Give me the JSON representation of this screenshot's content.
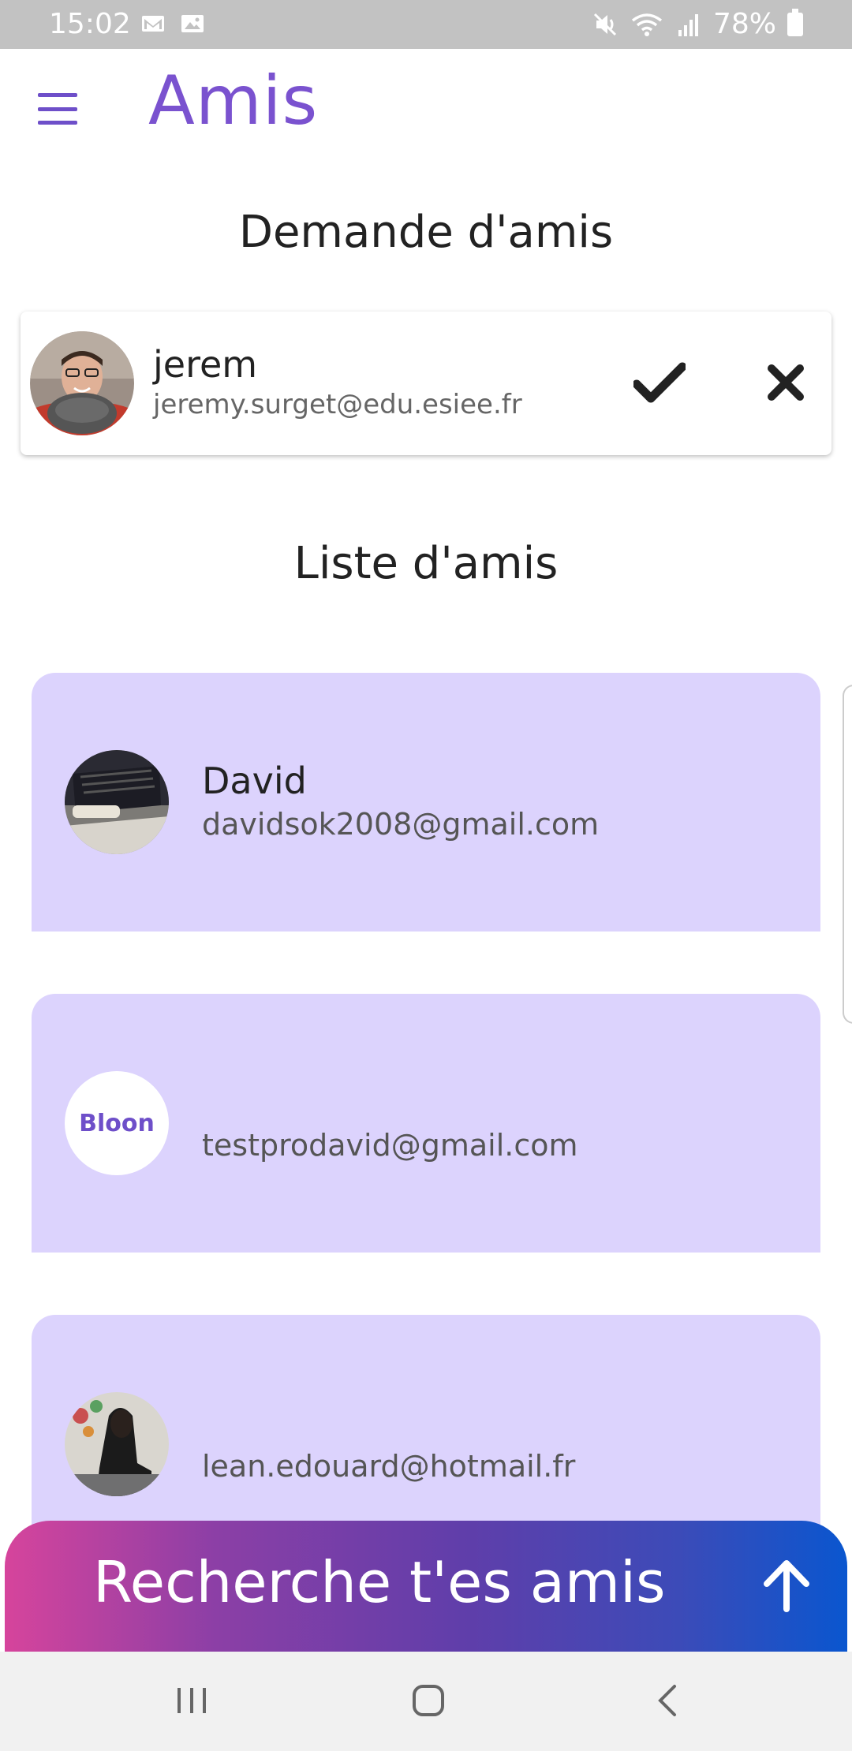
{
  "status_bar": {
    "time": "15:02",
    "battery": "78%",
    "icons": [
      "gmail-icon",
      "gallery-icon",
      "mute-icon",
      "wifi-icon",
      "signal-icon",
      "battery-icon"
    ]
  },
  "app_bar": {
    "title": "Amis",
    "menu_icon": "hamburger-menu-icon"
  },
  "requests": {
    "title": "Demande d'amis",
    "items": [
      {
        "name": "jerem",
        "email": "jeremy.surget@edu.esiee.fr"
      }
    ]
  },
  "friends": {
    "title": "Liste d'amis",
    "items": [
      {
        "name": "David",
        "email": "davidsok2008@gmail.com",
        "avatar": "photo"
      },
      {
        "name": "",
        "email": "testprodavid@gmail.com",
        "avatar_text": "Bloon"
      },
      {
        "name": "",
        "email": "lean.edouard@hotmail.fr",
        "avatar": "photo"
      }
    ]
  },
  "search_bar": {
    "label": "Recherche t'es amis",
    "icon": "arrow-up-icon"
  },
  "colors": {
    "accent": "#7a52cf",
    "card_bg": "#dcd3fd",
    "gradient_start": "#d6449c",
    "gradient_end": "#0a56cf"
  },
  "nav_bar": {
    "buttons": [
      "recents-icon",
      "home-icon",
      "back-icon"
    ]
  }
}
